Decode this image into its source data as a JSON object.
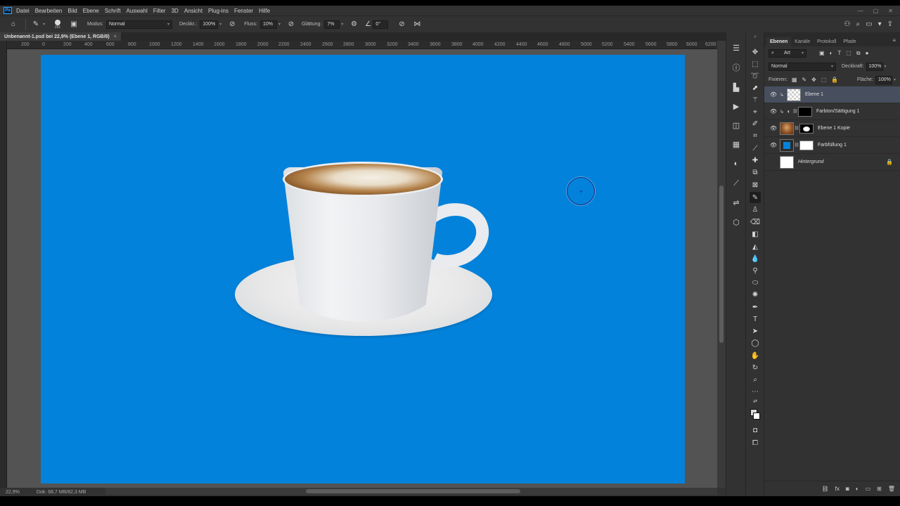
{
  "menubar": {
    "logo": "Ps",
    "items": [
      "Datei",
      "Bearbeiten",
      "Bild",
      "Ebene",
      "Schrift",
      "Auswahl",
      "Filter",
      "3D",
      "Ansicht",
      "Plug-ins",
      "Fenster",
      "Hilfe"
    ]
  },
  "options": {
    "brush_size": "291",
    "modus_label": "Modus:",
    "modus_value": "Normal",
    "deckkraft_label": "Deckkr.:",
    "deckkraft_value": "100%",
    "fluss_label": "Fluss:",
    "fluss_value": "10%",
    "glaettung_label": "Glättung:",
    "glaettung_value": "7%",
    "angle_value": "0°"
  },
  "document": {
    "tab_title": "Unbenannt-1.psd bei 22,9% (Ebene 1, RGB/8)",
    "close": "×"
  },
  "ruler": {
    "labels": [
      "200",
      "0",
      "200",
      "400",
      "600",
      "800",
      "1000",
      "1200",
      "1400",
      "1600",
      "1800",
      "2000",
      "2200",
      "2400",
      "2600",
      "2800",
      "3000",
      "3200",
      "3400",
      "3600",
      "3800",
      "4000",
      "4200",
      "4400",
      "4600",
      "4800",
      "5000",
      "5200",
      "5400",
      "5600",
      "5800",
      "6000",
      "6200"
    ]
  },
  "canvas": {
    "background_color": "#0282db"
  },
  "status": {
    "zoom": "22,9%",
    "doc_info": "Dok: 68,7 MB/82,3 MB"
  },
  "layers_panel": {
    "tabs": [
      "Ebenen",
      "Kanäle",
      "Protokoll",
      "Pfade"
    ],
    "filter_value": "Art",
    "blend_mode": "Normal",
    "opacity_label": "Deckkraft:",
    "opacity_value": "100%",
    "lock_label": "Fixieren:",
    "fill_label": "Fläche:",
    "fill_value": "100%",
    "layers": [
      {
        "name": "Ebene 1",
        "selected": true
      },
      {
        "name": "Farbton/Sättigung 1",
        "selected": false
      },
      {
        "name": "Ebene 1 Kopie",
        "selected": false
      },
      {
        "name": "Farbfüllung 1",
        "selected": false
      },
      {
        "name": "Hintergrund",
        "selected": false
      }
    ]
  },
  "colors": {
    "accent": "#31a8ff",
    "selected_layer": "#474f5e",
    "fill_layer_color": "#0282db"
  }
}
